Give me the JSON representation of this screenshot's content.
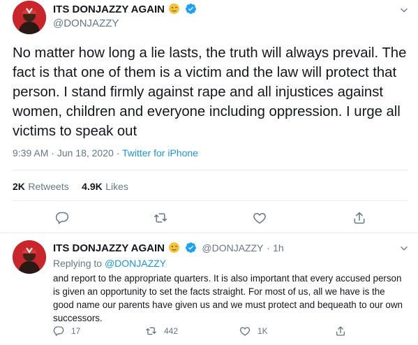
{
  "tweet": {
    "display_name": "ITS DONJAZZY AGAIN",
    "handle": "@DONJAZZY",
    "text": "No matter how long a lie lasts, the truth will always prevail. The fact is that one of them is a victim and the law will protect that person. I stand firmly against rape and all injustices against women, children and everyone including oppression. I urge all victims to speak out",
    "time": "9:39 AM",
    "separator": "·",
    "date": "Jun 18, 2020",
    "source": "Twitter for iPhone",
    "retweets_count": "2K",
    "retweets_label": "Retweets",
    "likes_count": "4.9K",
    "likes_label": "Likes"
  },
  "reply": {
    "display_name": "ITS DONJAZZY AGAIN",
    "handle": "@DONJAZZY",
    "separator": "·",
    "time_ago": "1h",
    "replying_to_label": "Replying to",
    "replying_to_handle": "@DONJAZZY",
    "text": "and report to the appropriate quarters. It is also important that every accused person is given an opportunity to set the facts straight. For most of us, all we have is the good name our parents have given us and we must protect and bequeath to our own successors.",
    "reply_count": "17",
    "retweet_count": "442",
    "like_count": "1K"
  },
  "colors": {
    "accent": "#1b95e0",
    "avatar": "#c9262c",
    "verified": "#1da1f2",
    "muted": "#657786"
  },
  "icons": [
    "verified-badge-icon",
    "emoji-icon",
    "chevron-down-icon",
    "reply-icon",
    "retweet-icon",
    "like-icon",
    "share-icon"
  ]
}
